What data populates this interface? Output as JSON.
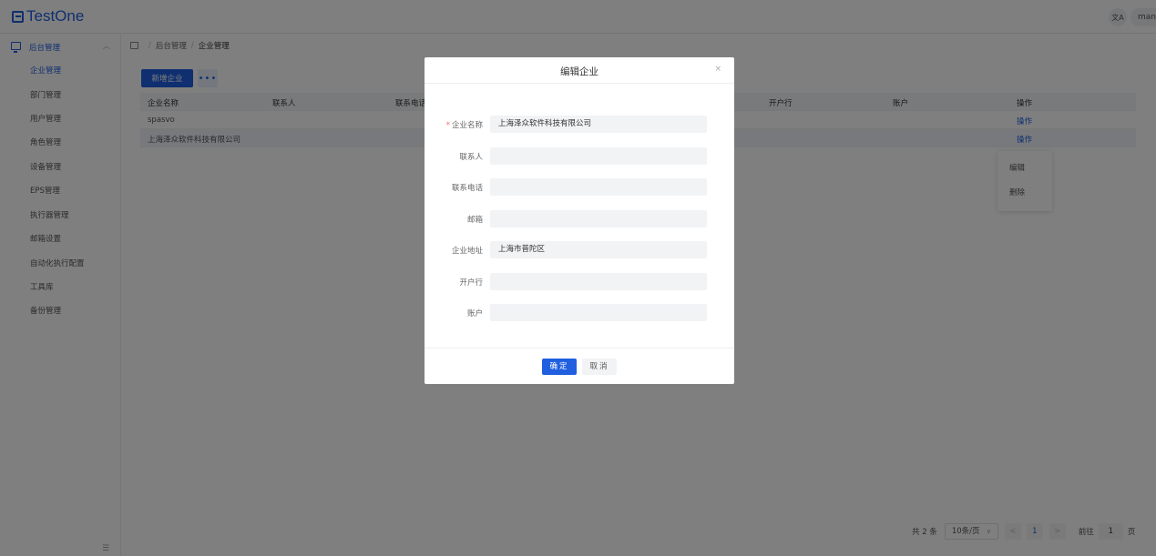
{
  "app": {
    "logo_text": "TestOne",
    "lang_icon": "translate-icon",
    "user_name": "manager"
  },
  "sidebar": {
    "group_label": "后台管理",
    "items": [
      {
        "label": "企业管理",
        "active": true
      },
      {
        "label": "部门管理"
      },
      {
        "label": "用户管理"
      },
      {
        "label": "角色管理"
      },
      {
        "label": "设备管理"
      },
      {
        "label": "EPS管理"
      },
      {
        "label": "执行器管理"
      },
      {
        "label": "邮箱设置"
      },
      {
        "label": "自动化执行配置"
      },
      {
        "label": "工具库"
      },
      {
        "label": "备份管理"
      }
    ],
    "collapse_icon": "menu-fold-icon"
  },
  "breadcrumb": {
    "items": [
      "后台管理",
      "企业管理"
    ],
    "separator": "/"
  },
  "toolbar": {
    "add_label": "新增企业",
    "more_label": "•••"
  },
  "table": {
    "headers": [
      "企业名称",
      "联系人",
      "联系电话",
      "开户行",
      "账户",
      "操作"
    ],
    "rows": [
      {
        "name": "spasvo",
        "op": "操作"
      },
      {
        "name": "上海泽众软件科技有限公司",
        "op": "操作"
      }
    ]
  },
  "dropdown": {
    "items": [
      "编辑",
      "删除"
    ]
  },
  "pagination": {
    "total": "共 2 条",
    "page_size": "10条/页",
    "prev": "<",
    "page": "1",
    "next": ">",
    "goto_label": "前往",
    "goto_value": "1",
    "page_unit": "页"
  },
  "modal": {
    "title": "编辑企业",
    "close": "×",
    "fields": [
      {
        "label": "企业名称",
        "required": "*",
        "value": "上海泽众软件科技有限公司"
      },
      {
        "label": "联系人",
        "value": ""
      },
      {
        "label": "联系电话",
        "value": ""
      },
      {
        "label": "邮箱",
        "value": ""
      },
      {
        "label": "企业地址",
        "value": "上海市普陀区"
      },
      {
        "label": "开户行",
        "value": ""
      },
      {
        "label": "账户",
        "value": ""
      }
    ],
    "ok_label": "确定",
    "cancel_label": "取消"
  },
  "colors": {
    "primary": "#1f5fe0",
    "mask": "rgba(0,0,0,0.5)"
  }
}
